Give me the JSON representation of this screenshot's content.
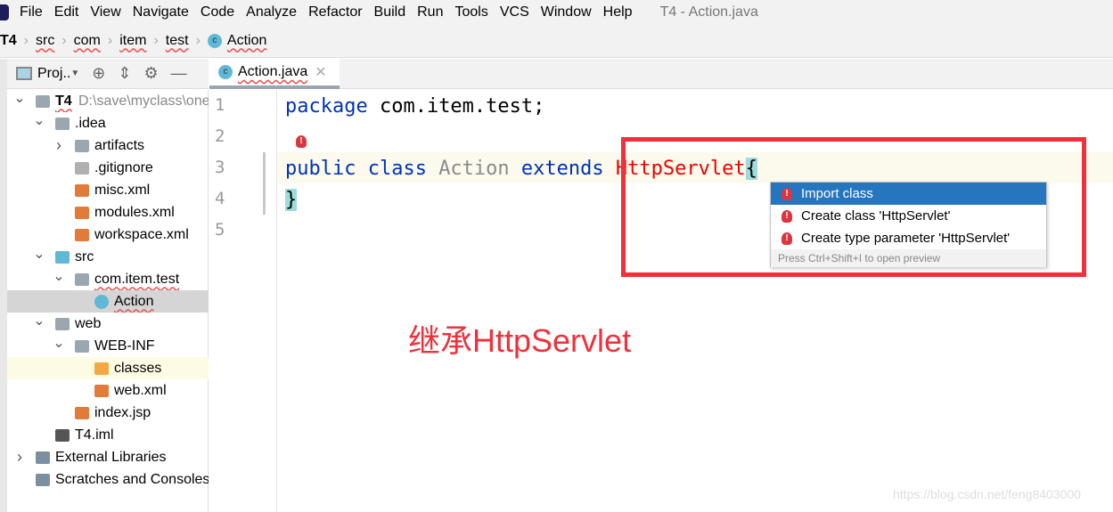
{
  "menubar": {
    "items": [
      "File",
      "Edit",
      "View",
      "Navigate",
      "Code",
      "Analyze",
      "Refactor",
      "Build",
      "Run",
      "Tools",
      "VCS",
      "Window",
      "Help"
    ],
    "title": "T4 - Action.java"
  },
  "breadcrumb": [
    "T4",
    "src",
    "com",
    "item",
    "test",
    "Action"
  ],
  "project_panel": {
    "label": "Proj..",
    "icons": [
      "locate-icon",
      "collapse-icon",
      "gear-icon",
      "minimize-icon"
    ]
  },
  "tree": [
    {
      "label": "T4",
      "extra": "D:\\save\\myclass\\one",
      "level": 0,
      "chev": "v",
      "icon": "module-folder",
      "color": "#9aa7b0"
    },
    {
      "label": ".idea",
      "level": 1,
      "chev": "v",
      "icon": "folder",
      "color": "#9aa7b0"
    },
    {
      "label": "artifacts",
      "level": 2,
      "chev": ">",
      "icon": "folder",
      "color": "#9aa7b0"
    },
    {
      "label": ".gitignore",
      "level": 2,
      "icon": "file",
      "color": "#b0b0b0"
    },
    {
      "label": "misc.xml",
      "level": 2,
      "icon": "xml",
      "color": "#e07b39"
    },
    {
      "label": "modules.xml",
      "level": 2,
      "icon": "xml",
      "color": "#e07b39"
    },
    {
      "label": "workspace.xml",
      "level": 2,
      "icon": "xml",
      "color": "#e07b39"
    },
    {
      "label": "src",
      "level": 1,
      "chev": "v",
      "icon": "source-folder",
      "color": "#5fb9d6"
    },
    {
      "label": "com.item.test",
      "level": 2,
      "chev": "v",
      "icon": "package",
      "color": "#9aa7b0"
    },
    {
      "label": "Action",
      "level": 3,
      "icon": "class",
      "color": "#5fb9d6",
      "selected": true
    },
    {
      "label": "web",
      "level": 1,
      "chev": "v",
      "icon": "web-folder",
      "color": "#9aa7b0"
    },
    {
      "label": "WEB-INF",
      "level": 2,
      "chev": "v",
      "icon": "folder",
      "color": "#9aa7b0"
    },
    {
      "label": "classes",
      "level": 3,
      "icon": "folder",
      "color": "#f4a742",
      "highlight": true
    },
    {
      "label": "web.xml",
      "level": 3,
      "icon": "xml",
      "color": "#e07b39"
    },
    {
      "label": "index.jsp",
      "level": 2,
      "icon": "jsp",
      "color": "#e07b39"
    },
    {
      "label": "T4.iml",
      "level": 1,
      "icon": "iml",
      "color": "#555"
    },
    {
      "label": "External Libraries",
      "level": 0,
      "chev": ">",
      "icon": "libraries",
      "color": "#7a8fa0"
    },
    {
      "label": "Scratches and Consoles",
      "level": 0,
      "icon": "scratches",
      "color": "#7a8fa0"
    }
  ],
  "tab": {
    "label": "Action.java"
  },
  "editor": {
    "line_numbers": [
      "1",
      "2",
      "3",
      "4",
      "5"
    ],
    "line1": {
      "kw": "package",
      "rest": " com.item.test;"
    },
    "line3": {
      "kw1": "public class ",
      "cls": "Action",
      "kw2": " extends ",
      "err": "HttpServlet",
      "brace": "{"
    },
    "line4": "}"
  },
  "popup": {
    "items": [
      "Import class",
      "Create class 'HttpServlet'",
      "Create type parameter 'HttpServlet'"
    ],
    "hint": "Press Ctrl+Shift+I to open preview"
  },
  "annotation": "继承HttpServlet",
  "watermark": "https://blog.csdn.net/feng8403000",
  "colors": {
    "accent": "#2675bf",
    "annotation": "#f0303a",
    "keyword": "#0033b3",
    "error": "#e00000"
  }
}
